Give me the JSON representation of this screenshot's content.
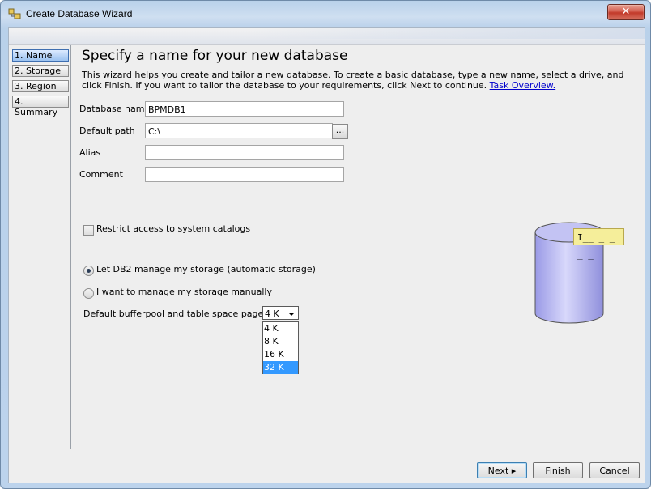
{
  "window": {
    "title": "Create Database Wizard",
    "close_label": "✕"
  },
  "nav": {
    "items": [
      {
        "label": "1. Name",
        "active": true
      },
      {
        "label": "2. Storage",
        "active": false
      },
      {
        "label": "3. Region",
        "active": false
      },
      {
        "label": "4. Summary",
        "active": false
      }
    ]
  },
  "page": {
    "heading": "Specify a name for your new database",
    "description": "This wizard helps you create and tailor a new database. To create a basic database, type a new name, select a drive, and click Finish. If you want to tailor the database to your requirements, click Next to continue.",
    "link": "Task Overview."
  },
  "form": {
    "database_name_label": "Database name",
    "database_name_value": "BPMDB1",
    "default_path_label": "Default path",
    "default_path_value": "C:\\",
    "browse_label": "...",
    "alias_label": "Alias",
    "alias_value": "",
    "comment_label": "Comment",
    "comment_value": "",
    "restrict_label": "Restrict access to system catalogs",
    "restrict_checked": false,
    "storage_auto_label": "Let DB2 manage my storage (automatic storage)",
    "storage_manual_label": "I want to manage my storage manually",
    "storage_selected": "auto",
    "pagesize_label": "Default bufferpool and table space page size",
    "pagesize_value": "4 K",
    "pagesize_options": [
      "4 K",
      "8 K",
      "16 K",
      "32 K"
    ],
    "pagesize_highlighted": "32 K"
  },
  "tooltip": {
    "text": "I̲_ _ _ _ _"
  },
  "buttons": {
    "next": "Next",
    "finish": "Finish",
    "cancel": "Cancel"
  },
  "colors": {
    "highlight": "#3399ff",
    "cylinder": "#b7b7f0",
    "tooltip_bg": "#f5ee9a"
  }
}
